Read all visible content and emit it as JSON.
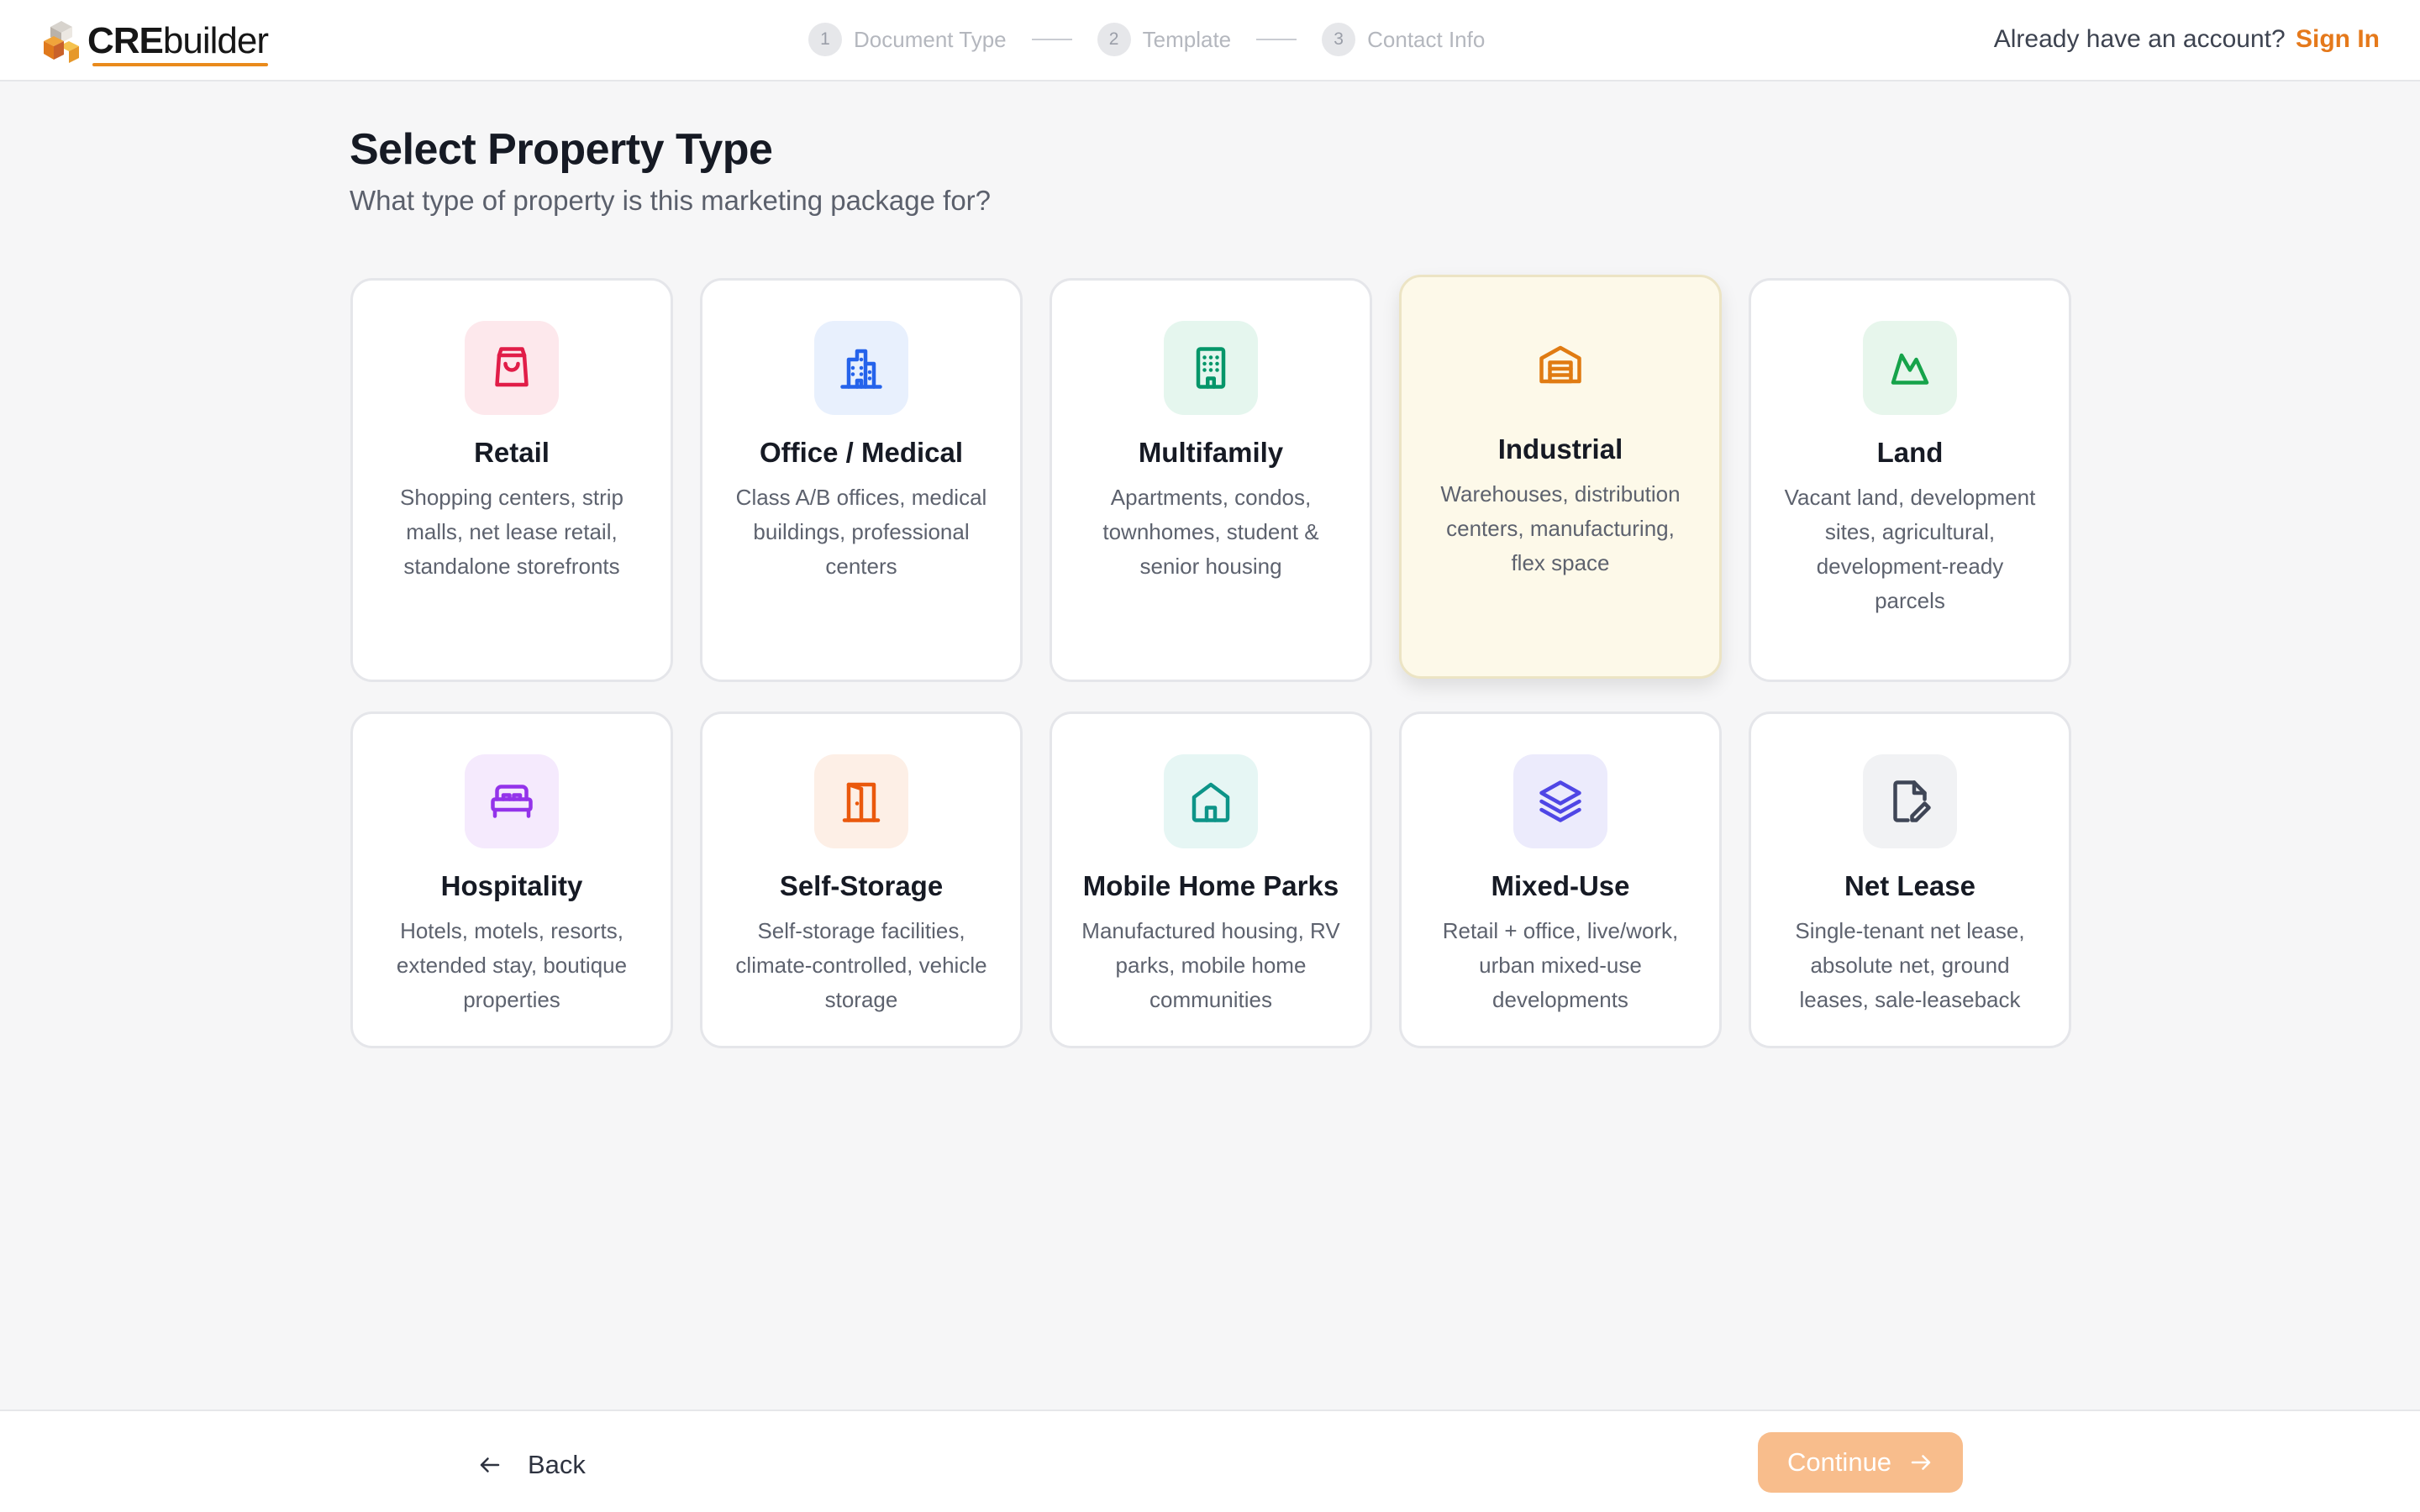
{
  "brand": {
    "name_bold": "CRE",
    "name_regular": "builder"
  },
  "stepper": [
    {
      "number": "1",
      "label": "Document Type"
    },
    {
      "number": "2",
      "label": "Template"
    },
    {
      "number": "3",
      "label": "Contact Info"
    }
  ],
  "account": {
    "prompt": "Already have an account?",
    "signin": "Sign In"
  },
  "page": {
    "title": "Select Property Type",
    "subtitle": "What type of property is this marketing package for?"
  },
  "property_types": [
    {
      "title": "Retail",
      "desc": "Shopping centers, strip malls, net lease retail, standalone storefronts",
      "icon": "shopping-bag-icon",
      "color": "#e11d48",
      "bg": "#fde8ec"
    },
    {
      "title": "Office / Medical",
      "desc": "Class A/B offices, medical buildings, professional centers",
      "icon": "office-building-icon",
      "color": "#2563eb",
      "bg": "#e8f0fd"
    },
    {
      "title": "Multifamily",
      "desc": "Apartments, condos, townhomes, student & senior housing",
      "icon": "apartment-building-icon",
      "color": "#059669",
      "bg": "#e5f6ee"
    },
    {
      "title": "Industrial",
      "desc": "Warehouses, distribution centers, manufacturing, flex space",
      "icon": "warehouse-icon",
      "color": "#e07b12",
      "bg": "transparent",
      "selected": true
    },
    {
      "title": "Land",
      "desc": "Vacant land, development sites, agricultural, development-ready parcels",
      "icon": "mountain-icon",
      "color": "#16a34a",
      "bg": "#e7f6ec"
    },
    {
      "title": "Hospitality",
      "desc": "Hotels, motels, resorts, extended stay, boutique properties",
      "icon": "bed-icon",
      "color": "#9333ea",
      "bg": "#f5eafd"
    },
    {
      "title": "Self-Storage",
      "desc": "Self-storage facilities, climate-controlled, vehicle storage",
      "icon": "door-icon",
      "color": "#ea580c",
      "bg": "#fdefe6"
    },
    {
      "title": "Mobile Home Parks",
      "desc": "Manufactured housing, RV parks, mobile home communities",
      "icon": "home-icon",
      "color": "#0d9488",
      "bg": "#e6f6f4"
    },
    {
      "title": "Mixed-Use",
      "desc": "Retail + office, live/work, urban mixed-use developments",
      "icon": "layers-icon",
      "color": "#4f46e5",
      "bg": "#ecebfc"
    },
    {
      "title": "Net Lease",
      "desc": "Single-tenant net lease, absolute net, ground leases, sale-leaseback",
      "icon": "document-edit-icon",
      "color": "#3f4656",
      "bg": "#f1f2f4"
    }
  ],
  "footer": {
    "back": "Back",
    "continue": "Continue"
  }
}
